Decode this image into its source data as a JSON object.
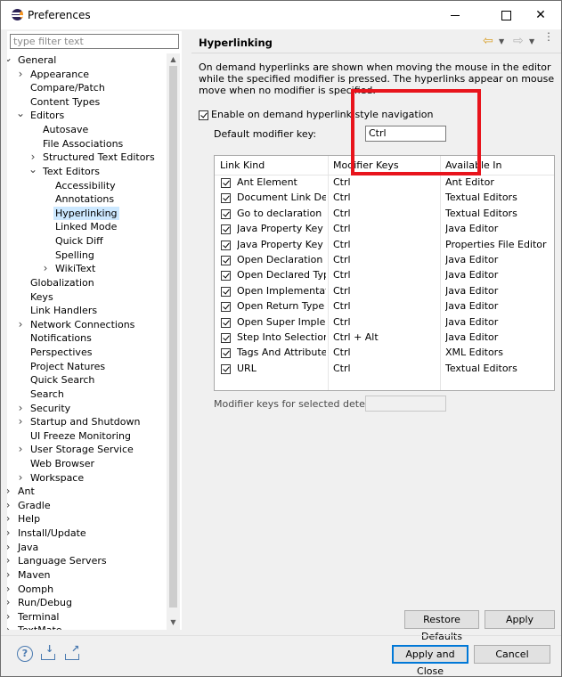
{
  "window": {
    "title": "Preferences",
    "close_glyph": "✕"
  },
  "filter": {
    "placeholder": "type filter text"
  },
  "tree": [
    {
      "label": "General",
      "level": 0,
      "twisty": "open"
    },
    {
      "label": "Appearance",
      "level": 1,
      "twisty": "closed"
    },
    {
      "label": "Compare/Patch",
      "level": 1,
      "twisty": "none"
    },
    {
      "label": "Content Types",
      "level": 1,
      "twisty": "none"
    },
    {
      "label": "Editors",
      "level": 1,
      "twisty": "open"
    },
    {
      "label": "Autosave",
      "level": 2,
      "twisty": "none"
    },
    {
      "label": "File Associations",
      "level": 2,
      "twisty": "none"
    },
    {
      "label": "Structured Text Editors",
      "level": 2,
      "twisty": "closed"
    },
    {
      "label": "Text Editors",
      "level": 2,
      "twisty": "open"
    },
    {
      "label": "Accessibility",
      "level": 3,
      "twisty": "none"
    },
    {
      "label": "Annotations",
      "level": 3,
      "twisty": "none"
    },
    {
      "label": "Hyperlinking",
      "level": 3,
      "twisty": "none",
      "selected": true
    },
    {
      "label": "Linked Mode",
      "level": 3,
      "twisty": "none"
    },
    {
      "label": "Quick Diff",
      "level": 3,
      "twisty": "none"
    },
    {
      "label": "Spelling",
      "level": 3,
      "twisty": "none"
    },
    {
      "label": "WikiText",
      "level": 3,
      "twisty": "closed"
    },
    {
      "label": "Globalization",
      "level": 1,
      "twisty": "none"
    },
    {
      "label": "Keys",
      "level": 1,
      "twisty": "none"
    },
    {
      "label": "Link Handlers",
      "level": 1,
      "twisty": "none"
    },
    {
      "label": "Network Connections",
      "level": 1,
      "twisty": "closed"
    },
    {
      "label": "Notifications",
      "level": 1,
      "twisty": "none"
    },
    {
      "label": "Perspectives",
      "level": 1,
      "twisty": "none"
    },
    {
      "label": "Project Natures",
      "level": 1,
      "twisty": "none"
    },
    {
      "label": "Quick Search",
      "level": 1,
      "twisty": "none"
    },
    {
      "label": "Search",
      "level": 1,
      "twisty": "none"
    },
    {
      "label": "Security",
      "level": 1,
      "twisty": "closed"
    },
    {
      "label": "Startup and Shutdown",
      "level": 1,
      "twisty": "closed"
    },
    {
      "label": "UI Freeze Monitoring",
      "level": 1,
      "twisty": "none"
    },
    {
      "label": "User Storage Service",
      "level": 1,
      "twisty": "closed"
    },
    {
      "label": "Web Browser",
      "level": 1,
      "twisty": "none"
    },
    {
      "label": "Workspace",
      "level": 1,
      "twisty": "closed"
    },
    {
      "label": "Ant",
      "level": 0,
      "twisty": "closed"
    },
    {
      "label": "Gradle",
      "level": 0,
      "twisty": "closed"
    },
    {
      "label": "Help",
      "level": 0,
      "twisty": "closed"
    },
    {
      "label": "Install/Update",
      "level": 0,
      "twisty": "closed"
    },
    {
      "label": "Java",
      "level": 0,
      "twisty": "closed"
    },
    {
      "label": "Language Servers",
      "level": 0,
      "twisty": "closed"
    },
    {
      "label": "Maven",
      "level": 0,
      "twisty": "closed"
    },
    {
      "label": "Oomph",
      "level": 0,
      "twisty": "closed"
    },
    {
      "label": "Run/Debug",
      "level": 0,
      "twisty": "closed"
    },
    {
      "label": "Terminal",
      "level": 0,
      "twisty": "closed"
    },
    {
      "label": "TextMate",
      "level": 0,
      "twisty": "closed"
    }
  ],
  "page": {
    "title": "Hyperlinking",
    "description": "On demand hyperlinks are shown when moving the mouse in the editor while the specified modifier is pressed. The hyperlinks appear on mouse move when no modifier is specified.",
    "enable_label": "Enable on demand hyperlink style navigation",
    "enable_checked": true,
    "modifier_label": "Default modifier key:",
    "modifier_value": "Ctrl",
    "detector_label": "Modifier keys for selected detector:",
    "detector_value": ""
  },
  "table": {
    "columns": [
      "Link Kind",
      "Modifier Keys",
      "Available In"
    ],
    "rows": [
      {
        "checked": true,
        "kind": "Ant Element",
        "keys": "Ctrl",
        "in": "Ant Editor"
      },
      {
        "checked": true,
        "kind": "Document Link De...",
        "keys": "Ctrl",
        "in": "Textual Editors"
      },
      {
        "checked": true,
        "kind": "Go to declaration",
        "keys": "Ctrl",
        "in": "Textual Editors"
      },
      {
        "checked": true,
        "kind": "Java Property Key",
        "keys": "Ctrl",
        "in": "Java Editor"
      },
      {
        "checked": true,
        "kind": "Java Property Key",
        "keys": "Ctrl",
        "in": "Properties File Editor"
      },
      {
        "checked": true,
        "kind": "Open Declaration",
        "keys": "Ctrl",
        "in": "Java Editor"
      },
      {
        "checked": true,
        "kind": "Open Declared Type",
        "keys": "Ctrl",
        "in": "Java Editor"
      },
      {
        "checked": true,
        "kind": "Open Implementati...",
        "keys": "Ctrl",
        "in": "Java Editor"
      },
      {
        "checked": true,
        "kind": "Open Return Type",
        "keys": "Ctrl",
        "in": "Java Editor"
      },
      {
        "checked": true,
        "kind": "Open Super Imple...",
        "keys": "Ctrl",
        "in": "Java Editor"
      },
      {
        "checked": true,
        "kind": "Step Into Selection",
        "keys": "Ctrl + Alt",
        "in": "Java Editor"
      },
      {
        "checked": true,
        "kind": "Tags And Attributes",
        "keys": "Ctrl",
        "in": "XML Editors"
      },
      {
        "checked": true,
        "kind": "URL",
        "keys": "Ctrl",
        "in": "Textual Editors"
      }
    ]
  },
  "buttons": {
    "restore_defaults": "Restore Defaults",
    "apply": "Apply",
    "apply_and_close": "Apply and Close",
    "cancel": "Cancel"
  },
  "icons": {
    "help": "?",
    "nav_back": "⇦",
    "nav_forward": "⇨",
    "dropdown": "▼",
    "view_menu": "⋮",
    "scroll_up": "▲",
    "scroll_down": "▼"
  },
  "colors": {
    "selection": "#cce8ff",
    "highlight_box": "#e8141c",
    "default_button_border": "#0078d7"
  }
}
